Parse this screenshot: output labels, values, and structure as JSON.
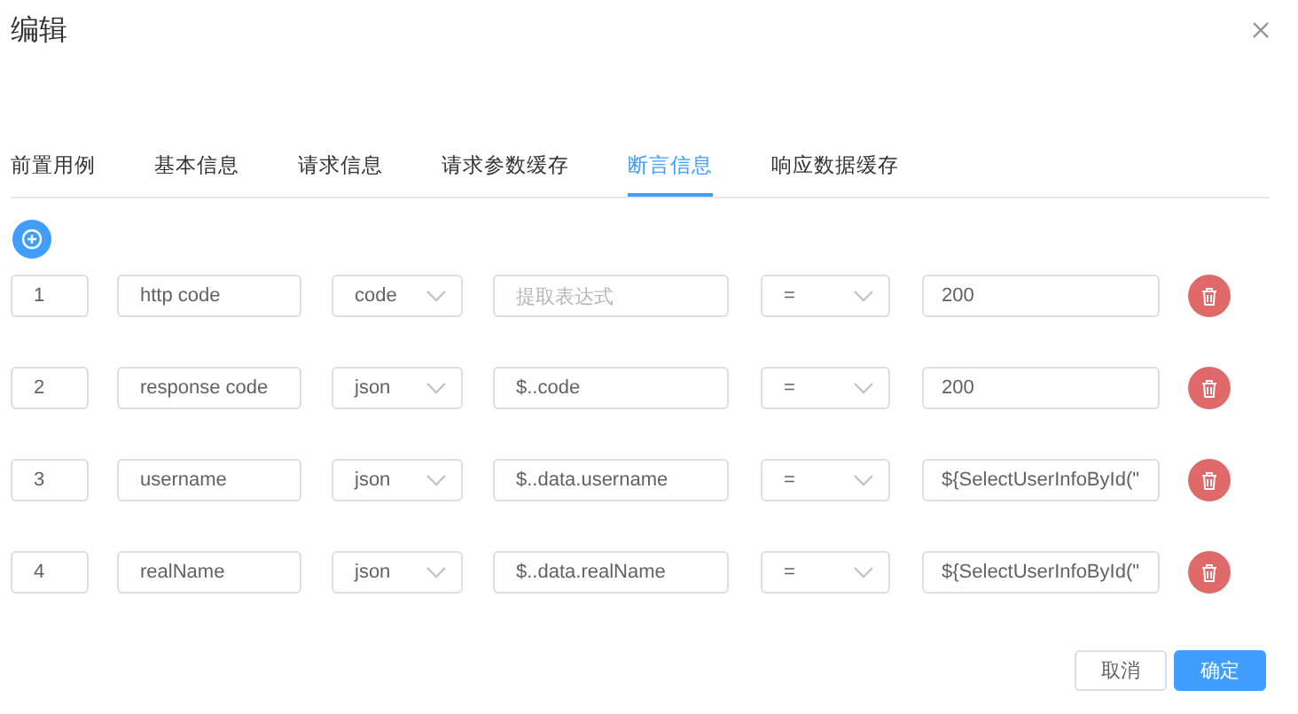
{
  "dialog": {
    "title": "编辑"
  },
  "tabs": [
    {
      "label": "前置用例",
      "selected": false
    },
    {
      "label": "基本信息",
      "selected": false
    },
    {
      "label": "请求信息",
      "selected": false
    },
    {
      "label": "请求参数缓存",
      "selected": false
    },
    {
      "label": "断言信息",
      "selected": true
    },
    {
      "label": "响应数据缓存",
      "selected": false
    }
  ],
  "assertions": [
    {
      "index": "1",
      "name": "http code",
      "type": "code",
      "expression_placeholder": "提取表达式",
      "operator": "=",
      "value": "200"
    },
    {
      "index": "2",
      "name": "response code",
      "type": "json",
      "expression": "$..code",
      "operator": "=",
      "value": "200"
    },
    {
      "index": "3",
      "name": "username",
      "type": "json",
      "expression": "$..data.username",
      "operator": "=",
      "value": "${SelectUserInfoById(\""
    },
    {
      "index": "4",
      "name": "realName",
      "type": "json",
      "expression": "$..data.realName",
      "operator": "=",
      "value": "${SelectUserInfoById(\""
    }
  ],
  "buttons": [
    {
      "label": "取消",
      "kind": "secondary"
    },
    {
      "label": "确定",
      "kind": "primary"
    }
  ]
}
